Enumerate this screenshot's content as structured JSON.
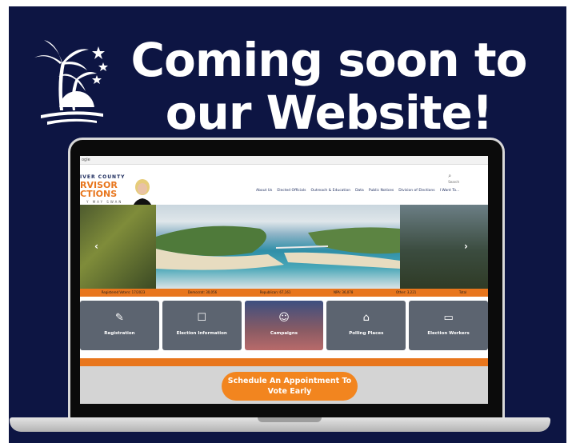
{
  "poster": {
    "headline_line1": "Coming soon to",
    "headline_line2": "our Website!",
    "logo_icon": "palm-tree-sunset-icon",
    "background_color": "#0d1543"
  },
  "site": {
    "topbar_text": "ogle",
    "brand": {
      "line1": "IVER COUNTY",
      "line2": "RVISOR",
      "line3": "CTIONS",
      "line4": "Y MAY SWAN"
    },
    "nav_items": [
      "About Us",
      "Elected Officials",
      "Outreach & Education",
      "Data",
      "Public Notices",
      "Division of Elections",
      "I Want To..."
    ],
    "search_label": "Search",
    "stats": [
      "Registered Voters: 17/2023",
      "Democrat: 30,056",
      "Republican: 67,161",
      "NPA: 36,078",
      "Other: 3,221",
      "Total"
    ],
    "tiles": [
      {
        "label": "Registration",
        "icon": "registration-icon"
      },
      {
        "label": "Election Information",
        "icon": "ballot-box-icon"
      },
      {
        "label": "Campaigns",
        "icon": "campaign-people-icon"
      },
      {
        "label": "Polling Places",
        "icon": "polling-place-icon"
      },
      {
        "label": "Election Workers",
        "icon": "id-card-icon"
      }
    ],
    "cta_line1": "Schedule An Appointment To",
    "cta_line2": "Vote Early",
    "accent_color": "#e8761d"
  }
}
